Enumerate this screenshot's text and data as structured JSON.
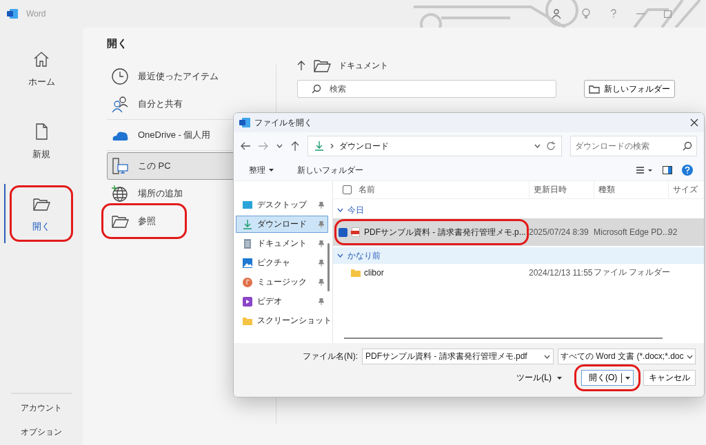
{
  "app": {
    "title": "Word"
  },
  "nav": [
    {
      "label": "ホーム",
      "selected": false,
      "highlighted": false
    },
    {
      "label": "新規",
      "selected": false,
      "highlighted": false
    },
    {
      "label": "開く",
      "selected": true,
      "highlighted": true
    }
  ],
  "nav_bottom": [
    "アカウント",
    "オプション"
  ],
  "open_pane": {
    "title": "開く",
    "location_groups": [
      [
        {
          "label": "最近使ったアイテム",
          "selected": false,
          "highlighted": false
        },
        {
          "label": "自分と共有",
          "selected": false,
          "highlighted": false
        }
      ],
      [
        {
          "label": "OneDrive - 個人用",
          "selected": false,
          "highlighted": false
        }
      ],
      [
        {
          "label": "この PC",
          "selected": true,
          "highlighted": false
        },
        {
          "label": "場所の追加",
          "selected": false,
          "highlighted": false
        },
        {
          "label": "参照",
          "selected": false,
          "highlighted": true
        }
      ]
    ]
  },
  "browser": {
    "path": "ドキュメント",
    "search_placeholder": "検索",
    "new_folder": "新しいフォルダー"
  },
  "dialog": {
    "title": "ファイルを開く",
    "address": "ダウンロード",
    "search_placeholder": "ダウンロードの検索",
    "organize": "整理",
    "new_folder": "新しいフォルダー",
    "sidebar": [
      {
        "label": "デスクトップ",
        "pinned": true,
        "selected": false
      },
      {
        "label": "ダウンロード",
        "pinned": true,
        "selected": true
      },
      {
        "label": "ドキュメント",
        "pinned": true,
        "selected": false
      },
      {
        "label": "ピクチャ",
        "pinned": true,
        "selected": false
      },
      {
        "label": "ミュージック",
        "pinned": true,
        "selected": false
      },
      {
        "label": "ビデオ",
        "pinned": true,
        "selected": false
      },
      {
        "label": "スクリーンショット",
        "pinned": false,
        "selected": false
      }
    ],
    "select_all": false,
    "columns": [
      "名前",
      "更新日時",
      "種類",
      "サイズ"
    ],
    "groups": [
      {
        "label": "今日",
        "hover": false,
        "rows": [
          {
            "kind": "pdf",
            "name": "PDFサンプル資料 - 請求書発行管理メモ.p...",
            "date": "2025/07/24 8:39",
            "type": "Microsoft Edge PD...",
            "size": "92",
            "selected": true,
            "highlighted": true
          }
        ]
      },
      {
        "label": "かなり前",
        "hover": true,
        "rows": [
          {
            "kind": "folder",
            "name": "clibor",
            "date": "2024/12/13 11:55",
            "type": "ファイル フォルダー",
            "size": "",
            "selected": false,
            "highlighted": false
          }
        ]
      }
    ],
    "file_name_label": "ファイル名(N):",
    "file_name": "PDFサンプル資料 - 請求書発行管理メモ.pdf",
    "file_type": "すべての Word 文書 (*.docx;*.doc",
    "tools": "ツール(L)",
    "open_button": {
      "label": "開く(O)",
      "highlighted": true
    },
    "cancel": "キャンセル"
  }
}
